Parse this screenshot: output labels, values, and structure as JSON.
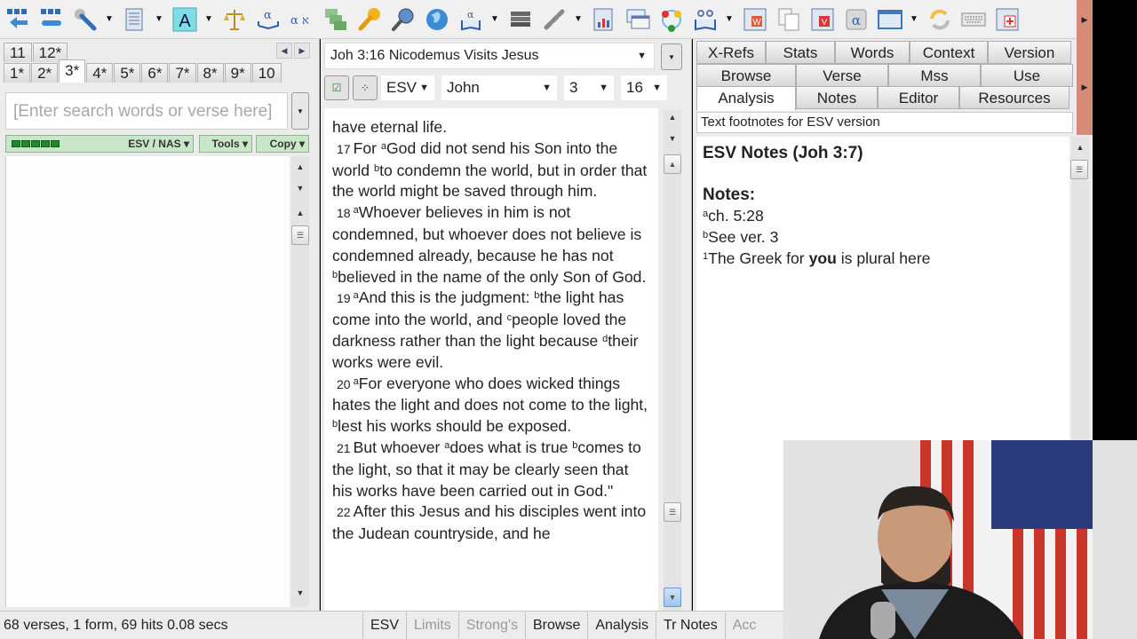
{
  "toolbar": {
    "icons": [
      "copy-text-icon",
      "fast-copy-icon",
      "tools-icon",
      "document-icon",
      "font-icon",
      "balance-icon",
      "alpha-book-icon",
      "alpha-aleph-icon",
      "multi-lexicon-icon",
      "key-icon",
      "magnifier-icon",
      "globe-icon",
      "alpha-lexicon-icon",
      "books-icon",
      "chain-link-icon",
      "chart-icon",
      "windows-icon",
      "cycle-icon",
      "reading-glasses-icon",
      "word-doc-icon",
      "pages-icon",
      "verse-list-icon",
      "alpha-key-icon",
      "window-book-icon",
      "refresh-icon",
      "keyboard-icon",
      "add-note-icon"
    ]
  },
  "left": {
    "tabs_row1": [
      "11",
      "12*"
    ],
    "tabs_row2": [
      "1*",
      "2*",
      "3*",
      "4*",
      "5*",
      "6*",
      "7*",
      "8*",
      "9*",
      "10"
    ],
    "active_tab": "3*",
    "search_placeholder": "[Enter search words or verse here]",
    "version_label": "ESV / NAS ▾",
    "tools_label": "Tools ▾",
    "copy_label": "Copy ▾"
  },
  "middle": {
    "reference": "Joh 3:16 Nicodemus Visits Jesus",
    "version": "ESV",
    "book": "John",
    "chapter": "3",
    "verse": "16",
    "passage": [
      {
        "num": "",
        "parts": [
          [
            "t",
            "have eternal life."
          ]
        ]
      },
      {
        "num": "17",
        "parts": [
          [
            "t",
            "For "
          ],
          [
            "f",
            "a"
          ],
          [
            "t",
            "God did not send his Son into the world "
          ],
          [
            "f",
            "b"
          ],
          [
            "t",
            "to condemn the world, but in order that the world might be saved through him."
          ]
        ]
      },
      {
        "num": "18",
        "parts": [
          [
            "f",
            "a"
          ],
          [
            "t",
            "Whoever believes in him is not condemned, but whoever does not believe is condemned already, because he has not "
          ],
          [
            "f",
            "b"
          ],
          [
            "t",
            "believed in the name of the only Son of God."
          ]
        ]
      },
      {
        "num": "19",
        "parts": [
          [
            "f",
            "a"
          ],
          [
            "t",
            "And this is the judgment: "
          ],
          [
            "f",
            "b"
          ],
          [
            "t",
            "the light has come into the world, and "
          ],
          [
            "f",
            "c"
          ],
          [
            "t",
            "people loved the darkness rather than the light because "
          ],
          [
            "f",
            "d"
          ],
          [
            "t",
            "their works were evil."
          ]
        ]
      },
      {
        "num": "20",
        "parts": [
          [
            "f",
            "a"
          ],
          [
            "t",
            "For everyone who does wicked things hates the light and does not come to the light, "
          ],
          [
            "f",
            "b"
          ],
          [
            "t",
            "lest his works should be exposed."
          ]
        ]
      },
      {
        "num": "21",
        "parts": [
          [
            "t",
            "But whoever "
          ],
          [
            "f",
            "a"
          ],
          [
            "t",
            "does what is true "
          ],
          [
            "f",
            "b"
          ],
          [
            "t",
            "comes to the light, so that it may be clearly seen that his works have been carried out in God.\""
          ]
        ]
      },
      {
        "num": "22",
        "parts": [
          [
            "t",
            "After this Jesus and his disciples went into the Judean countryside, and he"
          ]
        ]
      }
    ]
  },
  "right": {
    "tabs_row1": [
      "X-Refs",
      "Stats",
      "Words",
      "Context",
      "Version"
    ],
    "tabs_row2": [
      "Browse",
      "Verse",
      "Mss",
      "Use"
    ],
    "tabs_row3": [
      "Analysis",
      "Notes",
      "Editor",
      "Resources"
    ],
    "active_tab": "Analysis",
    "description": "Text footnotes for ESV version",
    "notes_title": "ESV Notes (Joh 3:7)",
    "notes_heading": "Notes:",
    "notes": [
      {
        "mark": "a",
        "text": "ch. 5:28"
      },
      {
        "mark": "b",
        "text": "See ver. 3"
      },
      {
        "mark": "1",
        "pre": "The Greek for ",
        "bold": "you",
        "post": " is plural here"
      }
    ]
  },
  "status": {
    "summary": "68 verses, 1 form, 69 hits 0.08 secs",
    "items": [
      {
        "label": "ESV",
        "enabled": true
      },
      {
        "label": "Limits",
        "enabled": false
      },
      {
        "label": "Strong's",
        "enabled": false
      },
      {
        "label": "Browse",
        "enabled": true
      },
      {
        "label": "Analysis",
        "enabled": true
      },
      {
        "label": "Tr Notes",
        "enabled": true
      },
      {
        "label": "Acc",
        "enabled": false
      }
    ]
  },
  "webcam": {
    "description": "Presenter webcam overlay with American flag background"
  },
  "colors": {
    "green_bar": "#c9e6c9",
    "scroll_accent": "#d88a78",
    "flag_red": "#c8352b",
    "flag_blue": "#2b3a7a"
  }
}
